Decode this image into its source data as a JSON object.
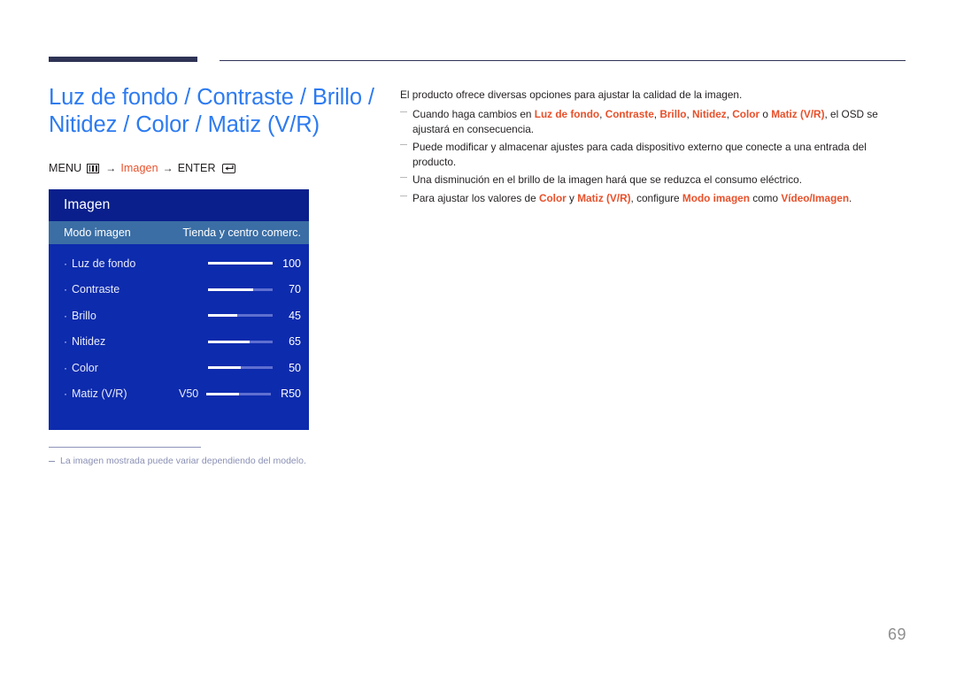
{
  "colors": {
    "title_blue": "#2d7bf0",
    "accent_orange": "#e8502a",
    "rule_navy": "#2f3355",
    "osd_body": "#0d2bad",
    "osd_header": "#0a1f8c",
    "osd_selected_row": "#3b6ea5",
    "footnote_gray": "#8a90b4",
    "page_number_gray": "#8f8f8f"
  },
  "page": {
    "title": "Luz de fondo / Contraste / Brillo /\nNitidez / Color / Matiz (V/R)",
    "number": "69"
  },
  "menu_path": {
    "menu_label": "MENU",
    "menu_icon": "menu-grid-icon",
    "arrow1": "→",
    "target": "Imagen",
    "arrow2": "→",
    "enter_label": "ENTER",
    "enter_icon": "enter-key-icon"
  },
  "osd": {
    "header_title": "Imagen",
    "selected_row": {
      "label": "Modo imagen",
      "value": "Tienda y centro comerc."
    },
    "rows": [
      {
        "bullet": "·",
        "label": "Luz de fondo",
        "left_cap": "",
        "value": "100",
        "fill_percent": 100
      },
      {
        "bullet": "·",
        "label": "Contraste",
        "left_cap": "",
        "value": "70",
        "fill_percent": 70
      },
      {
        "bullet": "·",
        "label": "Brillo",
        "left_cap": "",
        "value": "45",
        "fill_percent": 45
      },
      {
        "bullet": "·",
        "label": "Nitidez",
        "left_cap": "",
        "value": "65",
        "fill_percent": 65
      },
      {
        "bullet": "·",
        "label": "Color",
        "left_cap": "",
        "value": "50",
        "fill_percent": 50
      },
      {
        "bullet": "·",
        "label": "Matiz (V/R)",
        "left_cap": "V50",
        "value": "R50",
        "fill_percent": 50
      }
    ]
  },
  "image_footnote": {
    "text": "La imagen mostrada puede variar dependiendo del modelo."
  },
  "content": {
    "lead": "El producto ofrece diversas opciones para ajustar la calidad de la imagen.",
    "bullets": [
      {
        "parts": [
          {
            "t": "Cuando haga cambios en ",
            "hl": false
          },
          {
            "t": "Luz de fondo",
            "hl": true
          },
          {
            "t": ", ",
            "hl": false
          },
          {
            "t": "Contraste",
            "hl": true
          },
          {
            "t": ", ",
            "hl": false
          },
          {
            "t": "Brillo",
            "hl": true
          },
          {
            "t": ", ",
            "hl": false
          },
          {
            "t": "Nitidez",
            "hl": true
          },
          {
            "t": ", ",
            "hl": false
          },
          {
            "t": "Color",
            "hl": true
          },
          {
            "t": " o ",
            "hl": false
          },
          {
            "t": "Matiz (V/R)",
            "hl": true
          },
          {
            "t": ", el OSD se ajustará en consecuencia.",
            "hl": false
          }
        ]
      },
      {
        "parts": [
          {
            "t": "Puede modificar y almacenar ajustes para cada dispositivo externo que conecte a una entrada del producto.",
            "hl": false
          }
        ]
      },
      {
        "parts": [
          {
            "t": "Una disminución en el brillo de la imagen hará que se reduzca el consumo eléctrico.",
            "hl": false
          }
        ]
      },
      {
        "parts": [
          {
            "t": "Para ajustar los valores de ",
            "hl": false
          },
          {
            "t": "Color",
            "hl": true
          },
          {
            "t": " y ",
            "hl": false
          },
          {
            "t": "Matiz (V/R)",
            "hl": true
          },
          {
            "t": ", configure ",
            "hl": false
          },
          {
            "t": "Modo imagen",
            "hl": true
          },
          {
            "t": " como ",
            "hl": false
          },
          {
            "t": "Vídeo/Imagen",
            "hl": true
          },
          {
            "t": ".",
            "hl": false
          }
        ]
      }
    ]
  }
}
